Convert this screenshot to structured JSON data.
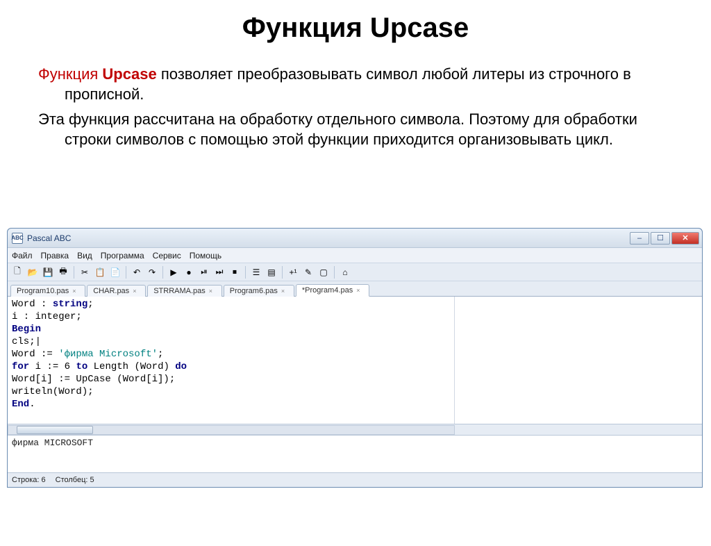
{
  "slide": {
    "title": "Функция Upcase",
    "p1_prefix": "Функция ",
    "p1_bold": "Upcase",
    "p1_rest": " позволяет преобразовывать символ любой литеры из строчного в прописной.",
    "p2": "Эта функция рассчитана на обработку отдельного символа. Поэтому для обработки строки символов с помощью этой функции приходится организовывать цикл."
  },
  "app": {
    "title": "Pascal ABC",
    "app_icon_text": "ABC",
    "menu": [
      "Файл",
      "Правка",
      "Вид",
      "Программа",
      "Сервис",
      "Помощь"
    ],
    "tabs": [
      {
        "label": "Program10.pas",
        "active": false
      },
      {
        "label": "CHAR.pas",
        "active": false
      },
      {
        "label": "STRRAMA.pas",
        "active": false
      },
      {
        "label": "Program6.pas",
        "active": false
      },
      {
        "label": "*Program4.pas",
        "active": true
      }
    ],
    "toolbar_icons": [
      "🗋",
      "📂",
      "💾",
      "🖶",
      "|",
      "✂",
      "📋",
      "📄",
      "|",
      "↶",
      "↷",
      "|",
      "▶",
      "●",
      "⏯",
      "⏭",
      "⏹",
      "|",
      "☰",
      "▤",
      "|",
      "+¹",
      "✎",
      "▢",
      "|",
      "⌂"
    ],
    "output": "фирма MICROSOFT",
    "status": {
      "line_label": "Строка:",
      "line_val": "6",
      "col_label": "Столбец:",
      "col_val": "5"
    }
  },
  "code": {
    "l1_a": "Word : ",
    "l1_kw": "string",
    "l1_b": ";",
    "l2": "i : integer;",
    "l3_kw": "Begin",
    "l4": "cls;|",
    "l5_a": "Word := ",
    "l5_str": "'фирма Microsoft'",
    "l5_b": ";",
    "l6_a": "for",
    "l6_b": " i := 6 ",
    "l6_c": "to",
    "l6_d": " Length (Word) ",
    "l6_e": "do",
    "l7": "Word[i] := UpCase (Word[i]);",
    "l8": "writeln(Word);",
    "l9_kw": "End",
    "l9_b": "."
  }
}
